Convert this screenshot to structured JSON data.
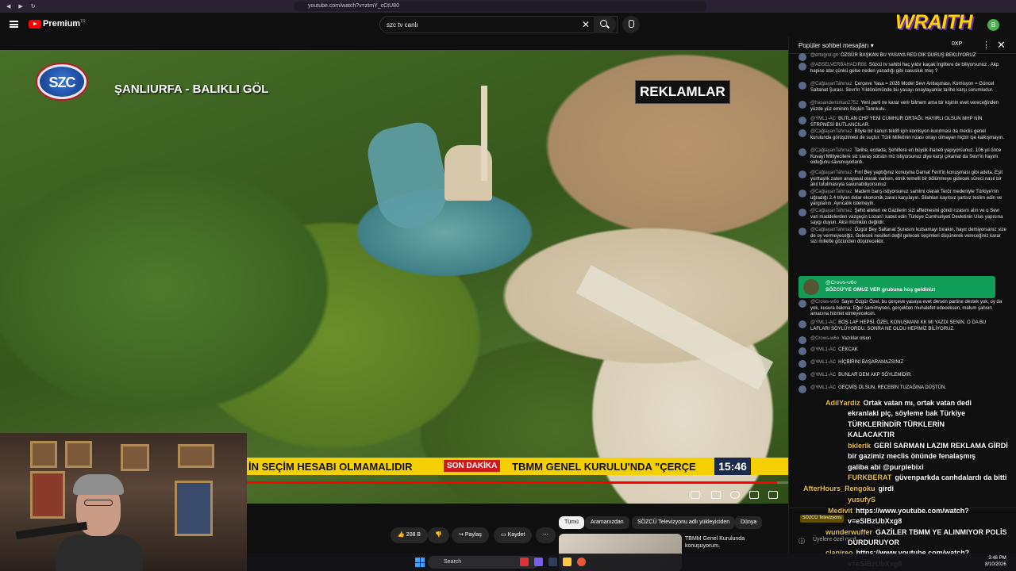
{
  "browser": {
    "url": "youtube.com/watch?v=ztmY_cCtU80"
  },
  "masthead": {
    "brand": "Premium",
    "brand_sup": "TR",
    "search_value": "szc tv canlı"
  },
  "video": {
    "channel_logo": "SZC",
    "location_title": "ŞANLIURFA - BALIKLI GÖL",
    "ad_badge": "REKLAMLAR",
    "ticker_left": "İN SEÇİM HESABI OLMAMALIDIR",
    "ticker_tag": "SON DAKİKA",
    "ticker_right": "TBMM GENEL KURULU'NDA \"ÇERÇE",
    "clock": "15:46",
    "progress_fraction": 0.98
  },
  "below": {
    "like_count": "208 B",
    "share_label": "Paylaş",
    "save_label": "Kaydet",
    "chips": [
      "Tümü",
      "Aramanızdan",
      "SÖZCÜ Televizyonu adlı yükleyiciden",
      "Dünya"
    ],
    "rec_title": "TBMM Genel Kurulunda konuşuyorum."
  },
  "chat": {
    "header_title": "Popüler sohbet mesajları",
    "xp_label": "0XP",
    "messages": [
      {
        "name": "@ertugrul-gn",
        "text": "ÖZGÜR BAŞKAN BU YASAYA RED DİK DURUŞ BEKLİYORUZ"
      },
      {
        "name": "@ABSELVERBAHADIR88",
        "text": "Sözcü tv sahibi haç yıldır kaçak İngiltere de biliyorsunuz . Akp hapise atar çünkü gelse neden yasadığı gibi casusluk muş ?"
      },
      {
        "name": "@CağlayanTahmaz",
        "text": "Çerçeve Yasa = 2026 Model Sevr Antlaşması, Komisyon = Güncel Saltanat Şurası. Sevr'in Yıldönümünde bu yasayı onaylayanlar tarihe karşı sorumludur."
      },
      {
        "name": "@hasandemirkan2752",
        "text": "Yeni parti ne karar verir bilmem ama bir kişinin evet vereceğinden yüzde yüz eminim Seçkin Tanrıkulu."
      },
      {
        "name": "@YML1-AC",
        "text": "BUTLAN CHP YENİ CUMHUR ORTAĞI. HAYIRLI OLSUN MHP NİN STRPNESİ BUTLANCILAR."
      },
      {
        "name": "@CağlayanTahmaz",
        "text": "Böyle bir kanun teklifi için komisyon kurulması da meclis genel kurulunda görüşülmesi de suçtur. Türk Milletinin rızası onayı olmayan hiçbir işe kalkışmayın."
      },
      {
        "name": "@CağlayanTahmaz",
        "text": "Tarihe, ecdada, Şehitlere en büyük ihaneti yapıyorsunuz. 106 yıl önce Kuvayi Milliyecilere siz savaş sürsün mü istiyorsunuz diye karşı çıkanlar da Sevr'in hayırlı olduğunu savunuyorlardı."
      },
      {
        "name": "@CağlayanTahmaz",
        "text": "Fırıl Bey yaptığınız konuşma Damat Ferit'in konuşması gibi adeta. Eşit yurttaşlık zaten anayasal olarak varken, etnik temelli bir bölünmeye gidecek süreci nasıl bir akıl tutulmasıyla savunabiliyorsunuz"
      },
      {
        "name": "@CağlayanTahmaz",
        "text": "Madem barış istiyorsunuz samimi olarak Terör medeniyle Türkiye'nin uğradığı 2.4 trilyon dolar ekonomik zararı karşılayın. Silahları kayıtsız şartsız teslim edin ve yargılanın. Ayrıcalık istemeyin."
      },
      {
        "name": "@CağlayanTahmaz",
        "text": "Şehit aileleri ve Gazilerin sizi affetmesini gönül rızasını alın ve o Sevr vari maddelerden vazgeçin Lozan'ı kabul edin Türkiye Cumhuriyeti Devletinin Ulus yapısına saygı duyun. Aksi mümkün değildir."
      },
      {
        "name": "@CağlayanTahmaz",
        "text": "Özgür Bey Saltanat Şurasını kutsamayı bırakın, hayır demiyorsanız size de oy vermeyeceğiz. Gelecek nesilleri değil gelecek seçimleri düşünerek vereceğiniz karar sizi millette gözünden düşürecektir."
      }
    ],
    "welcome_name": "@Crows-w6o",
    "welcome_text": "SÖZCÜ'YE OMUZ VER grubuna hoş geldiniz!",
    "messages2": [
      {
        "name": "@Crows-w6o",
        "text": "Sayın Özgür Özel, bu çerçeve yasaya evet dersen partine destek yok, oy da yok, kusura bakma. Eğer samimiysen, gerçekten muhalefet edeceksen, malum şahsın amacına hizmet etmeyeceksin."
      },
      {
        "name": "@YML1-AC",
        "text": "BOŞ LAF HEPSİ. ÖZEL KONUŞMANI KK MI YAZDI SENİN. O DA BU LAFLARI SÖYLÜYORDU. SONRA NE OLDU HEPİMİZ BİLİYORUZ."
      },
      {
        "name": "@Crows-w6o",
        "text": "Yazıklar olsun"
      },
      {
        "name": "@YML1-AC",
        "text": "CEKCAK"
      },
      {
        "name": "@YML1-AC",
        "text": "HİÇBİRİNİ BAŞARAMAZSINIZ"
      },
      {
        "name": "@YML1-AC",
        "text": "BUNLAR DEM AKP SÖYLEMİDİR"
      },
      {
        "name": "@YML1-AC",
        "text": "GEÇMİŞ OLSUN. RECEBİN TUZAĞINA DÜŞTÜN."
      }
    ],
    "sozcu_pill": "SÖZCÜ Televizyonu",
    "input_placeholder": "Üyelere özel mod"
  },
  "overlay": {
    "wraith": "WRAITH",
    "wraith_badge": "B",
    "lines": [
      {
        "user": "AdilYardiz",
        "text": "Ortak vatan mı, ortak vatan dedi"
      },
      {
        "user": "",
        "text": "ekranlaki piç, söyleme bak Türkiye"
      },
      {
        "user": "",
        "text": "TÜRKLERİNDİR TÜRKLERİN"
      },
      {
        "user": "",
        "text": "KALACAKTIR"
      },
      {
        "user": "bklerik",
        "text": "GERİ SARMAN LAZIM REKLAMA GİRDİ"
      },
      {
        "user": "",
        "text": "bir gazimiz meclis önünde fenalaşmış"
      },
      {
        "user": "",
        "text": "galiba abi @purplebixi"
      },
      {
        "user": "FURKBERAT",
        "text": "güvenparkda canhdalardı da bitti"
      },
      {
        "user": "AfterHours_Rengoku",
        "text": "girdi"
      },
      {
        "user": "yusufyS",
        "text": ""
      },
      {
        "user": "Medivit",
        "text": "https://www.youtube.com/watch?"
      },
      {
        "user": "",
        "text": "v=eSIBzUbXxg8"
      },
      {
        "user": "wunderwuffer",
        "text": "GAZİLER TBMM YE ALINMIYOR POLİS"
      },
      {
        "user": "",
        "text": "DURDURUYOR"
      },
      {
        "user": "clanireo",
        "text": "https://www.youtube.com/watch?"
      },
      {
        "user": "",
        "text": "v=eSIBzUbXxg8"
      }
    ]
  },
  "taskbar": {
    "search": "Search",
    "time": "3:46 PM",
    "date": "8/10/2026",
    "lang": "TUR"
  },
  "colors": {
    "accent": "#ff0000",
    "ticker": "#f5d000",
    "welcome": "#0f9d58",
    "wraith": "#ffd200"
  }
}
